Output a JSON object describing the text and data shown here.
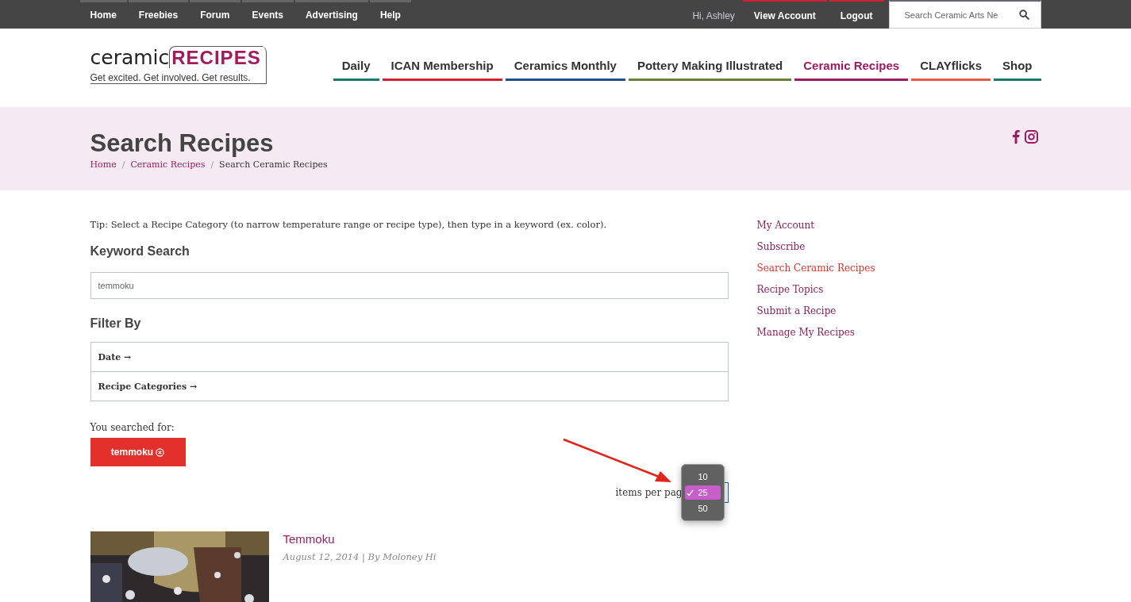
{
  "top_bar": {
    "links": [
      "Home",
      "Freebies",
      "Forum",
      "Events",
      "Advertising",
      "Help"
    ],
    "greeting": "Hi, Ashley",
    "account_links": [
      "View Account",
      "Logout"
    ],
    "search": {
      "placeholder": "Search Ceramic Arts Ne"
    }
  },
  "logo": {
    "word": "ceramic",
    "brand": "RECIPES",
    "tagline": "Get excited. Get involved. Get results."
  },
  "main_nav": [
    {
      "label": "Daily",
      "color": "#1a7a6e",
      "selected": false
    },
    {
      "label": "ICAN Membership",
      "color": "#d0222f",
      "selected": false
    },
    {
      "label": "Ceramics Monthly",
      "color": "#1f4f8f",
      "selected": false
    },
    {
      "label": "Pottery Making Illustrated",
      "color": "#6a7f3a",
      "selected": false
    },
    {
      "label": "Ceramic Recipes",
      "color": "#9c1a62",
      "selected": true
    },
    {
      "label": "CLAYflicks",
      "color": "#e85a46",
      "selected": false
    },
    {
      "label": "Shop",
      "color": "#1a7a6e",
      "selected": false
    }
  ],
  "banner": {
    "title": "Search Recipes",
    "separator": "/",
    "breadcrumb": [
      {
        "label": "Home",
        "link": true
      },
      {
        "label": "Ceramic Recipes",
        "link": true
      },
      {
        "label": "Search Ceramic Recipes",
        "link": false
      }
    ]
  },
  "tip": "Tip: Select a Recipe Category (to narrow temperature range or recipe type), then type in a keyword (ex. color).",
  "keyword_search": {
    "heading": "Keyword Search",
    "value": "temmoku"
  },
  "filter": {
    "heading": "Filter By",
    "sections": [
      "Date →",
      "Recipe Categories →"
    ]
  },
  "searched_for": {
    "label": "You searched for:",
    "tag": "temmoku"
  },
  "per_page": {
    "label": "items per pag",
    "options": [
      {
        "label": "10",
        "selected": false
      },
      {
        "label": "25",
        "selected": true
      },
      {
        "label": "50",
        "selected": false
      }
    ]
  },
  "results": [
    {
      "title": "Temmoku",
      "meta": "August 12, 2014 | By Moloney Hi"
    }
  ],
  "sidebar": [
    {
      "label": "My Account",
      "selected": false
    },
    {
      "label": "Subscribe",
      "selected": false
    },
    {
      "label": "Search Ceramic Recipes",
      "selected": true
    },
    {
      "label": "Recipe Topics",
      "selected": false
    },
    {
      "label": "Submit a Recipe",
      "selected": false
    },
    {
      "label": "Manage My Recipes",
      "selected": false
    }
  ]
}
